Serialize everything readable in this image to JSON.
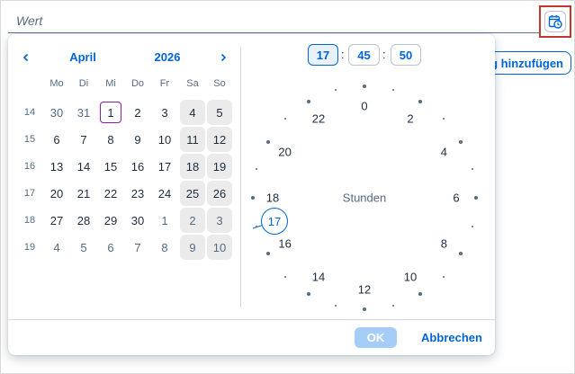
{
  "input": {
    "placeholder": "Wert"
  },
  "toolbar": {
    "add_label": "g hinzufügen",
    "picker_icon": "calendar-clock-icon"
  },
  "calendar": {
    "month": "April",
    "year": "2026",
    "weekdays": [
      "Mo",
      "Di",
      "Mi",
      "Do",
      "Fr",
      "Sa",
      "So"
    ],
    "weeks": [
      {
        "wk": "14",
        "days": [
          "30",
          "31",
          "1",
          "2",
          "3",
          "4",
          "5"
        ]
      },
      {
        "wk": "15",
        "days": [
          "6",
          "7",
          "8",
          "9",
          "10",
          "11",
          "12"
        ]
      },
      {
        "wk": "16",
        "days": [
          "13",
          "14",
          "15",
          "16",
          "17",
          "18",
          "19"
        ]
      },
      {
        "wk": "17",
        "days": [
          "20",
          "21",
          "22",
          "23",
          "24",
          "25",
          "26"
        ]
      },
      {
        "wk": "18",
        "days": [
          "27",
          "28",
          "29",
          "30",
          "1",
          "2",
          "3"
        ]
      },
      {
        "wk": "19",
        "days": [
          "4",
          "5",
          "6",
          "7",
          "8",
          "9",
          "10"
        ]
      }
    ]
  },
  "time": {
    "hours": "17",
    "minutes": "45",
    "seconds": "50",
    "separator": ":"
  },
  "clock": {
    "center_label": "Stunden",
    "selected": "17",
    "labels": [
      "0",
      "2",
      "4",
      "6",
      "8",
      "10",
      "12",
      "14",
      "16",
      "18",
      "20",
      "22"
    ]
  },
  "footer": {
    "ok": "OK",
    "cancel": "Abbrechen"
  },
  "colors": {
    "accent": "#0064d9",
    "today_border": "#8c1ca0",
    "highlight": "#c0392b"
  }
}
